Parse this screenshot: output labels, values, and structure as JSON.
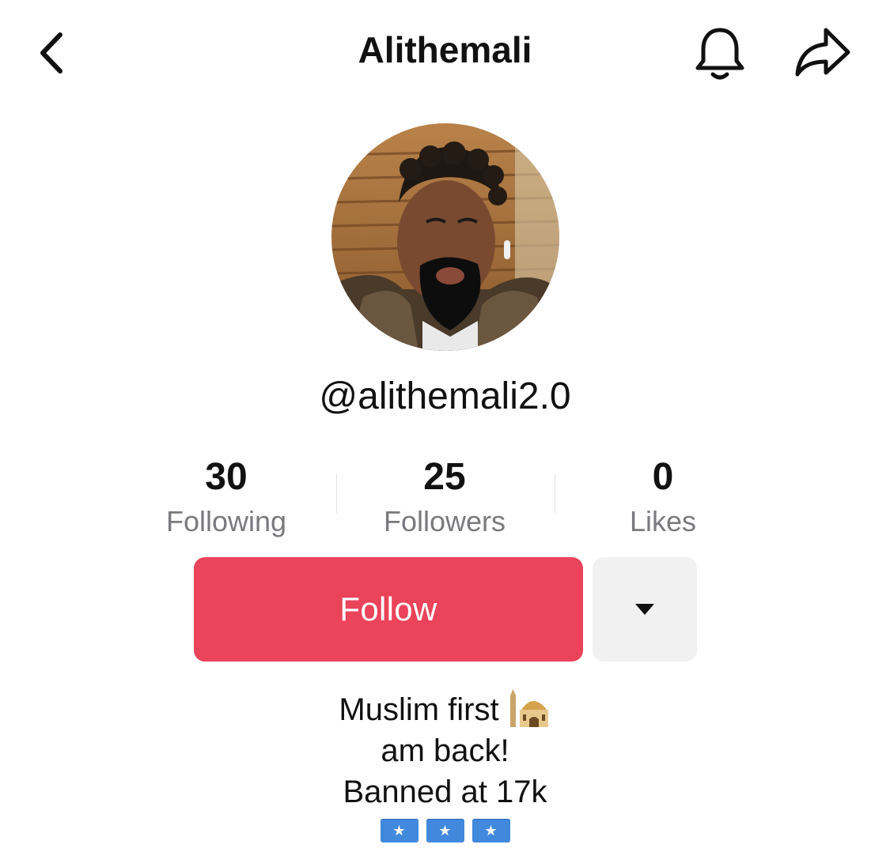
{
  "header": {
    "title": "Alithemali",
    "back_icon": "chevron-left-icon",
    "bell_icon": "bell-icon",
    "share_icon": "share-arrow-icon"
  },
  "profile": {
    "avatar": "profile-photo",
    "username": "@alithemali2.0"
  },
  "stats": [
    {
      "value": "30",
      "label": "Following"
    },
    {
      "value": "25",
      "label": "Followers"
    },
    {
      "value": "0",
      "label": "Likes"
    }
  ],
  "actions": {
    "follow_label": "Follow",
    "follow_color": "#ea435a",
    "more_icon": "caret-down-icon"
  },
  "bio": {
    "line1": "Muslim first",
    "line1_emoji": "mosque-emoji",
    "line2": "am back!",
    "line3": "Banned at 17k",
    "flags": [
      "somalia-flag-emoji",
      "somalia-flag-emoji",
      "somalia-flag-emoji"
    ]
  }
}
